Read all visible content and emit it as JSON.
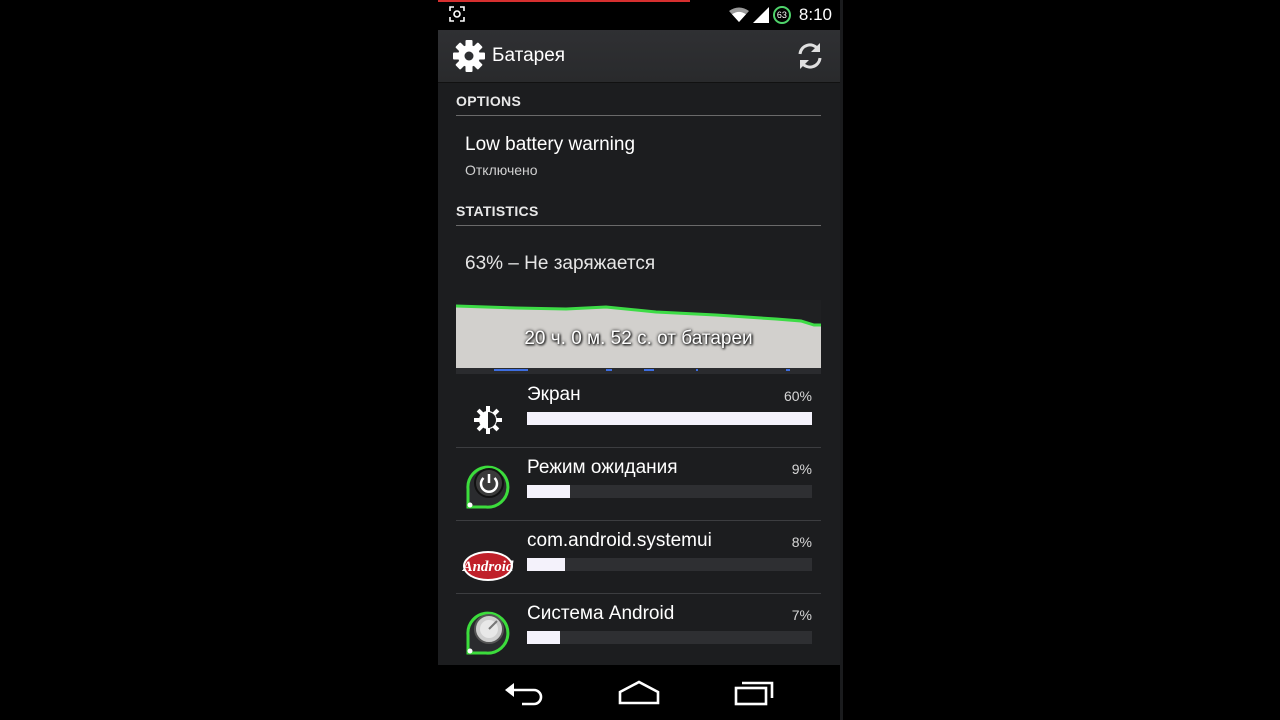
{
  "status_bar": {
    "time": "8:10",
    "battery_level": "63",
    "accent_color": "#d62f2f",
    "battery_ring_color": "#4fd36b"
  },
  "action_bar": {
    "title": "Батарея",
    "icons": [
      "settings-icon",
      "refresh-icon"
    ]
  },
  "options": {
    "header": "OPTIONS",
    "low_battery": {
      "title": "Low battery warning",
      "value": "Отключено"
    }
  },
  "statistics": {
    "header": "STATISTICS",
    "status": "63% – Не заряжается",
    "graph_label": "20 ч. 0 м. 52 с. от батареи"
  },
  "usage": [
    {
      "label": "Экран",
      "percent_text": "60%",
      "percent": 60,
      "icon": "brightness-icon"
    },
    {
      "label": "Режим ожидания",
      "percent_text": "9%",
      "percent": 9,
      "icon": "power-standby-icon"
    },
    {
      "label": "com.android.systemui",
      "percent_text": "8%",
      "percent": 8,
      "icon": "android-logo-icon"
    },
    {
      "label": "Система Android",
      "percent_text": "7%",
      "percent": 7,
      "icon": "android-system-icon"
    }
  ],
  "nav_bar": {
    "icons": [
      "back-icon",
      "home-icon",
      "recents-icon"
    ]
  }
}
